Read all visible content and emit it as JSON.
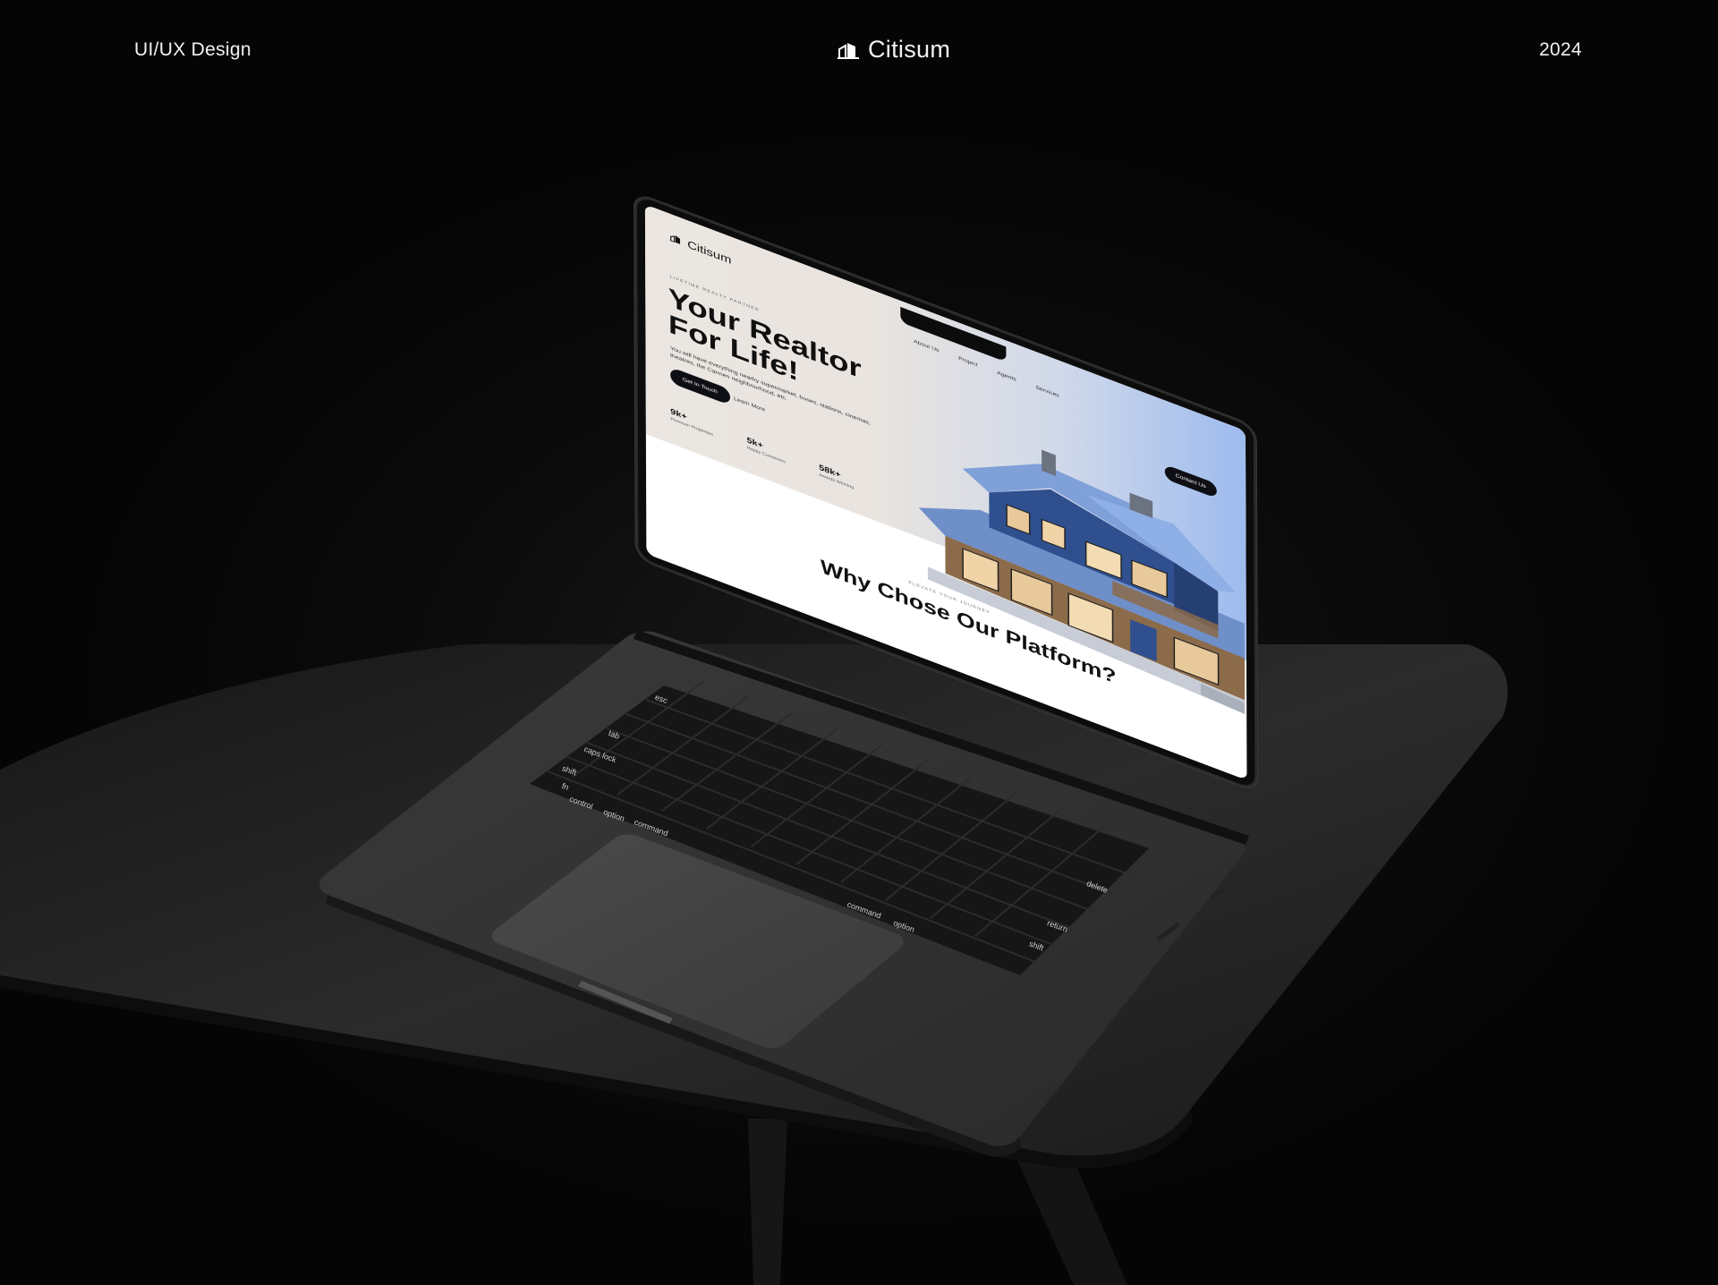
{
  "header": {
    "left_text": "UI/UX Design",
    "brand": "Citisum",
    "right_text": "2024"
  },
  "screen": {
    "logo": "Citisum",
    "nav": [
      "About Us",
      "Project",
      "Agents",
      "Services"
    ],
    "contact_button": "Contact Us",
    "eyebrow": "LIFETIME REALTY PARTNER",
    "title_line1": "Your Realtor",
    "title_line2": "For Life!",
    "description": "You will have everything nearby supermarket, buses, stations, cinemas, theatres, the Carmen neighbourhood, etc.",
    "primary_cta": "Get In Touch",
    "secondary_cta": "Learn More",
    "stats": [
      {
        "value": "9k+",
        "label": "Premium Properties"
      },
      {
        "value": "5k+",
        "label": "Happy Customers"
      },
      {
        "value": "58k+",
        "label": "Awards Winning"
      }
    ],
    "section_eyebrow": "ELEVATE YOUR JOURNEY",
    "section_title": "Why Chose Our Platform?"
  },
  "keyboard": {
    "labels": [
      "esc",
      "tab",
      "caps lock",
      "shift",
      "fn",
      "control",
      "option",
      "command",
      "command",
      "option",
      "shift",
      "return",
      "delete"
    ]
  },
  "colors": {
    "background": "#050505",
    "hero_gradient_start": "#ebe6e1",
    "hero_gradient_end": "#9dbbee",
    "button": "#0e0f14"
  }
}
